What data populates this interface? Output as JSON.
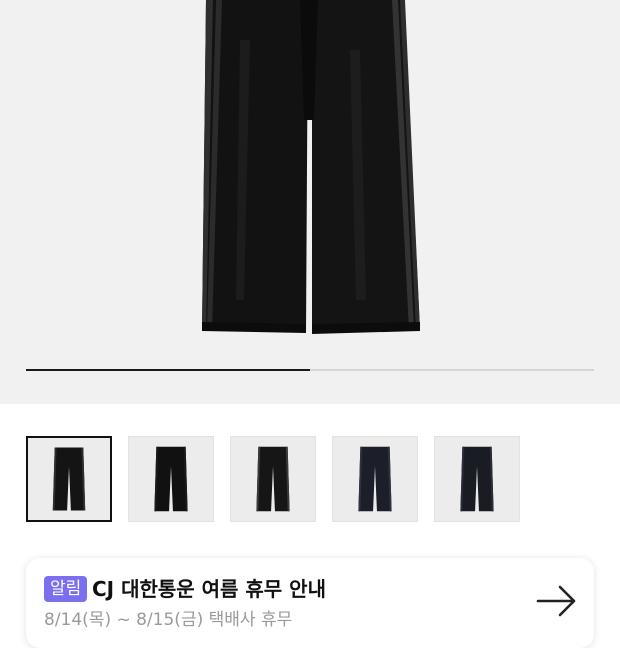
{
  "gallery": {
    "progress": 0.5,
    "active_thumbnail": 1,
    "thumbnails": [
      {
        "name": "black-velour-pants-front",
        "shade": "#141414",
        "stripe": "#2e2e2e"
      },
      {
        "name": "black-velour-pants-back",
        "shade": "#111111",
        "stripe": "#1b1b1b"
      },
      {
        "name": "black-velour-pants-side",
        "shade": "#161616",
        "stripe": "#3a3a3a"
      },
      {
        "name": "navy-velour-pants-front",
        "shade": "#1c1f2a",
        "stripe": "#2e3240"
      },
      {
        "name": "navy-velour-pants-back",
        "shade": "#1a1c24",
        "stripe": "#2a2d38"
      }
    ]
  },
  "notice": {
    "badge": "알림",
    "title": "CJ 대한통운 여름 휴무 안내",
    "subtitle": "8/14(목) ~ 8/15(금) 택배사 휴무"
  },
  "colors": {
    "accent": "#7b6ff0",
    "hero_background": "#f1f1f1"
  }
}
